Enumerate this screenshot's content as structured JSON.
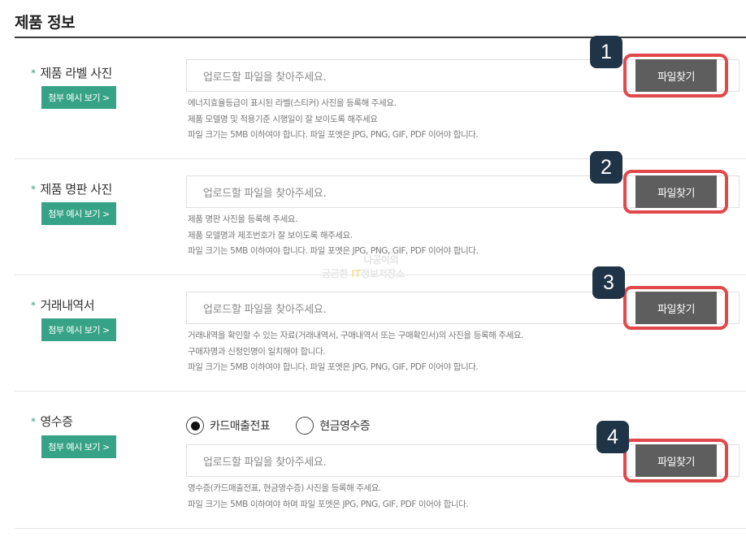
{
  "section": {
    "title": "제품 정보"
  },
  "rows": [
    {
      "label": "제품 라벨 사진",
      "example_button": "첨부 예시 보기 >",
      "placeholder": "업로드할 파일을 찾아주세요.",
      "find_button": "파일찾기",
      "badge": "1",
      "help": [
        "에너지효율등급이 표시된 라벨(스티커) 사진을 등록해 주세요.",
        "제품 모델명 및 적용기준 시행일이 잘 보이도록 해주세요",
        "파일 크기는 5MB 이하여야 합니다. 파일 포멧은 JPG, PNG, GIF, PDF 이어야 합니다."
      ]
    },
    {
      "label": "제품 명판 사진",
      "example_button": "첨부 예시 보기 >",
      "placeholder": "업로드할 파일을 찾아주세요.",
      "find_button": "파일찾기",
      "badge": "2",
      "help": [
        "제품 명판 사진을 등록해 주세요.",
        "제품 모델명과 제조번호가 잘 보이도록 해주세요.",
        "파일 크기는 5MB 이하여야 합니다. 파일 포멧은 JPG, PNG, GIF, PDF 이어야 합니다."
      ]
    },
    {
      "label": "거래내역서",
      "example_button": "첨부 예시 보기 >",
      "placeholder": "업로드할 파일을 찾아주세요.",
      "find_button": "파일찾기",
      "badge": "3",
      "help": [
        "거래내역을 확인할 수 있는 자료(거래내역서, 구매내역서 또는 구매확인서)의 사진을 등록해 주세요.",
        "구매자명과 신청인명이 일치해야 합니다.",
        "파일 크기는 5MB 이하여야 합니다. 파일 포멧은 JPG, PNG, GIF, PDF 이어야 합니다."
      ]
    },
    {
      "label": "영수증",
      "example_button": "첨부 예시 보기 >",
      "placeholder": "업로드할 파일을 찾아주세요.",
      "find_button": "파일찾기",
      "badge": "4",
      "radios": [
        {
          "label": "카드매출전표",
          "selected": true
        },
        {
          "label": "현금영수증",
          "selected": false
        }
      ],
      "help": [
        "영수증(카드매출전표, 현금영수증) 사진을 등록해 주세요.",
        "파일 크기는 5MB 이하여야 하며 파일 포멧은 JPG, PNG, GIF, PDF 이어야 합니다."
      ]
    }
  ],
  "watermark": {
    "line1": "나공이의",
    "line2_a": "궁금한 ",
    "line2_it": "IT",
    "line2_b": "정보저장소"
  },
  "colors": {
    "accent": "#36a386",
    "find_button": "#5e5e5e",
    "highlight": "#e0484a",
    "badge": "#1f3447"
  }
}
